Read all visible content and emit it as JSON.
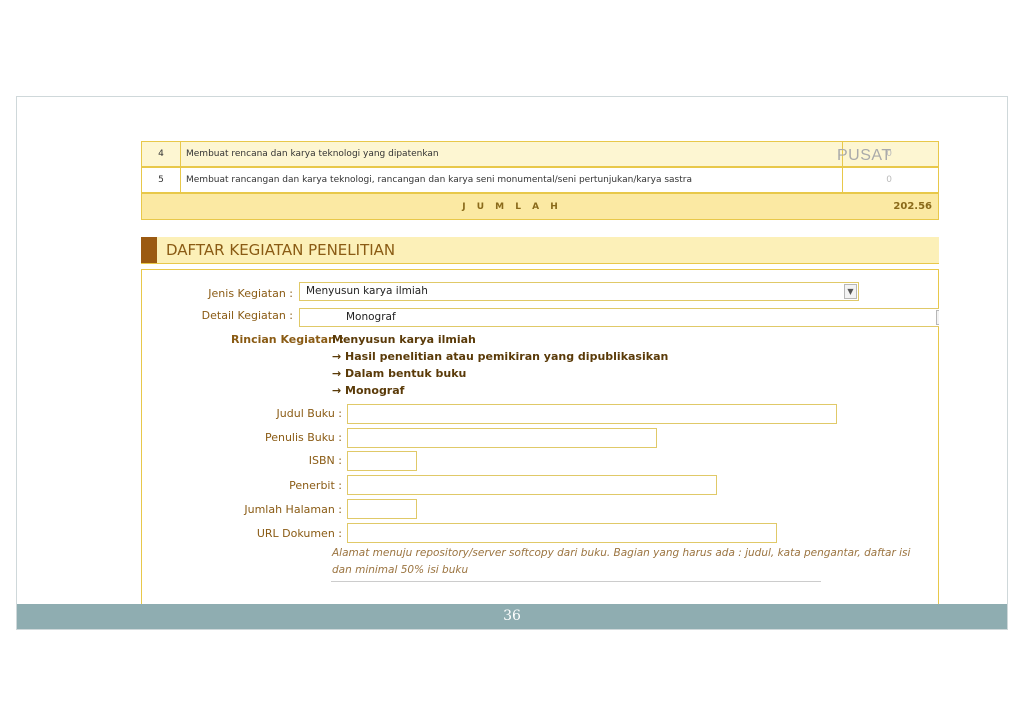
{
  "table": {
    "rows": [
      {
        "no": "4",
        "desc": "Membuat rencana dan karya teknologi yang dipatenkan",
        "value": "0"
      },
      {
        "no": "5",
        "desc": "Membuat rancangan dan karya teknologi, rancangan dan karya seni monumental/seni pertunjukan/karya sastra",
        "value": "0"
      }
    ],
    "watermark": "PUSAT",
    "jumlah_label": "J U M L A H",
    "jumlah_value": "202.56"
  },
  "section": {
    "title": "DAFTAR KEGIATAN PENELITIAN"
  },
  "form": {
    "jenis_label": "Jenis Kegiatan :",
    "jenis_value": "Menyusun karya ilmiah",
    "detail_label": "Detail Kegiatan :",
    "detail_value": "Monograf",
    "rincian_label": "Rincian Kegiatan :",
    "rincian_lines": [
      "Menyusun karya ilmiah",
      "→ Hasil penelitian atau pemikiran yang dipublikasikan",
      "→ Dalam bentuk buku",
      "→ Monograf"
    ],
    "judul_label": "Judul Buku :",
    "penulis_label": "Penulis Buku :",
    "isbn_label": "ISBN :",
    "penerbit_label": "Penerbit :",
    "halaman_label": "Jumlah Halaman :",
    "url_label": "URL Dokumen :",
    "url_hint": "Alamat menuju repository/server softcopy dari buku. Bagian yang harus ada : judul, kata pengantar, daftar isi dan minimal 50% isi buku"
  },
  "footer": {
    "page_number": "36"
  }
}
